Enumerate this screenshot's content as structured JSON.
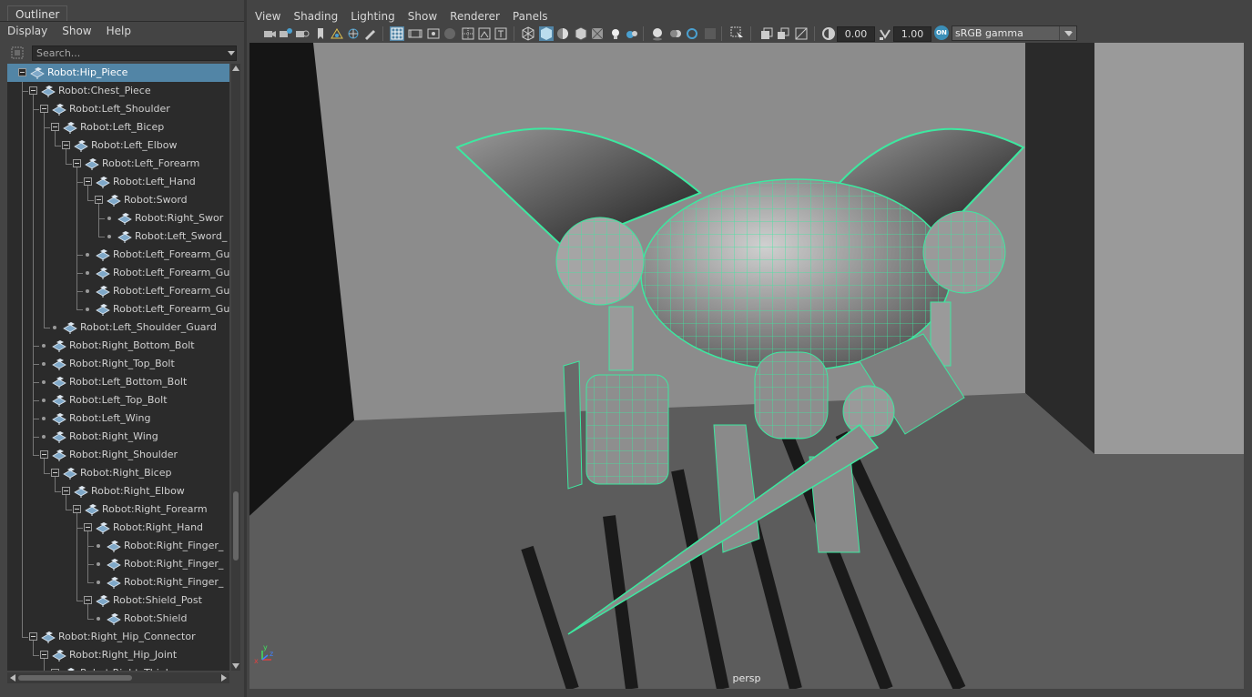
{
  "outliner": {
    "tab_label": "Outliner",
    "menu": [
      "Display",
      "Show",
      "Help"
    ],
    "search_placeholder": "Search...",
    "items": [
      {
        "label": "Robot:Hip_Piece",
        "depth": 0,
        "kind": "expand",
        "selected": true
      },
      {
        "label": "Robot:Chest_Piece",
        "depth": 1,
        "kind": "expand"
      },
      {
        "label": "Robot:Left_Shoulder",
        "depth": 2,
        "kind": "expand"
      },
      {
        "label": "Robot:Left_Bicep",
        "depth": 3,
        "kind": "expand"
      },
      {
        "label": "Robot:Left_Elbow",
        "depth": 4,
        "kind": "expand"
      },
      {
        "label": "Robot:Left_Forearm",
        "depth": 5,
        "kind": "expand"
      },
      {
        "label": "Robot:Left_Hand",
        "depth": 6,
        "kind": "expand"
      },
      {
        "label": "Robot:Sword",
        "depth": 7,
        "kind": "expand"
      },
      {
        "label": "Robot:Right_Swor",
        "depth": 8,
        "kind": "leaf"
      },
      {
        "label": "Robot:Left_Sword_",
        "depth": 8,
        "kind": "leaf"
      },
      {
        "label": "Robot:Left_Forearm_Gu",
        "depth": 6,
        "kind": "leaf"
      },
      {
        "label": "Robot:Left_Forearm_Gu",
        "depth": 6,
        "kind": "leaf"
      },
      {
        "label": "Robot:Left_Forearm_Gu",
        "depth": 6,
        "kind": "leaf"
      },
      {
        "label": "Robot:Left_Forearm_Gu",
        "depth": 6,
        "kind": "leaf"
      },
      {
        "label": "Robot:Left_Shoulder_Guard",
        "depth": 3,
        "kind": "leaf"
      },
      {
        "label": "Robot:Right_Bottom_Bolt",
        "depth": 2,
        "kind": "leaf"
      },
      {
        "label": "Robot:Right_Top_Bolt",
        "depth": 2,
        "kind": "leaf"
      },
      {
        "label": "Robot:Left_Bottom_Bolt",
        "depth": 2,
        "kind": "leaf"
      },
      {
        "label": "Robot:Left_Top_Bolt",
        "depth": 2,
        "kind": "leaf"
      },
      {
        "label": "Robot:Left_Wing",
        "depth": 2,
        "kind": "leaf"
      },
      {
        "label": "Robot:Right_Wing",
        "depth": 2,
        "kind": "leaf"
      },
      {
        "label": "Robot:Right_Shoulder",
        "depth": 2,
        "kind": "expand"
      },
      {
        "label": "Robot:Right_Bicep",
        "depth": 3,
        "kind": "expand"
      },
      {
        "label": "Robot:Right_Elbow",
        "depth": 4,
        "kind": "expand"
      },
      {
        "label": "Robot:Right_Forearm",
        "depth": 5,
        "kind": "expand"
      },
      {
        "label": "Robot:Right_Hand",
        "depth": 6,
        "kind": "expand"
      },
      {
        "label": "Robot:Right_Finger_",
        "depth": 7,
        "kind": "leaf"
      },
      {
        "label": "Robot:Right_Finger_",
        "depth": 7,
        "kind": "leaf"
      },
      {
        "label": "Robot:Right_Finger_",
        "depth": 7,
        "kind": "leaf"
      },
      {
        "label": "Robot:Shield_Post",
        "depth": 6,
        "kind": "expand"
      },
      {
        "label": "Robot:Shield",
        "depth": 7,
        "kind": "leaf"
      },
      {
        "label": "Robot:Right_Hip_Connector",
        "depth": 1,
        "kind": "expand"
      },
      {
        "label": "Robot:Right_Hip_Joint",
        "depth": 2,
        "kind": "expand"
      },
      {
        "label": "Robot:Right_Thigh",
        "depth": 3,
        "kind": "expand"
      }
    ]
  },
  "viewport": {
    "menu": [
      "View",
      "Shading",
      "Lighting",
      "Show",
      "Renderer",
      "Panels"
    ],
    "exposure": "0.00",
    "gamma": "1.00",
    "color_management_toggle": "ON",
    "color_space": "sRGB gamma",
    "camera_label": "persp",
    "wireframe_color": "#3de8a0",
    "axis_labels": {
      "x": "x",
      "y": "y",
      "z": "z"
    }
  }
}
